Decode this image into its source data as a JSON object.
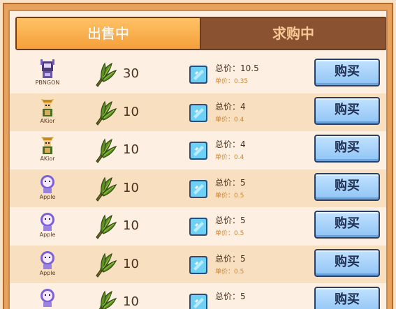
{
  "tabs": {
    "sell": "出售中",
    "buy": "求购中"
  },
  "listings": [
    {
      "seller": "PBNGON",
      "avatar": "robot-avatar-icon",
      "quantity": "30",
      "total_label": "总价：",
      "total": "10.5",
      "unit_label": "单价：",
      "unit_price": "0.35",
      "button": "购买",
      "row_style": "plain"
    },
    {
      "seller": "AKior",
      "avatar": "warrior-avatar-icon",
      "quantity": "10",
      "total_label": "总价：",
      "total": "4",
      "unit_label": "单价：",
      "unit_price": "0.4",
      "button": "购买",
      "row_style": "alt"
    },
    {
      "seller": "AKior",
      "avatar": "warrior-avatar-icon",
      "quantity": "10",
      "total_label": "总价：",
      "total": "4",
      "unit_label": "单价：",
      "unit_price": "0.4",
      "button": "购买",
      "row_style": "plain"
    },
    {
      "seller": "Apple",
      "avatar": "astronaut-avatar-icon",
      "quantity": "10",
      "total_label": "总价：",
      "total": "5",
      "unit_label": "单价：",
      "unit_price": "0.5",
      "button": "购买",
      "row_style": "alt"
    },
    {
      "seller": "Apple",
      "avatar": "astronaut-avatar-icon",
      "quantity": "10",
      "total_label": "总价：",
      "total": "5",
      "unit_label": "单价：",
      "unit_price": "0.5",
      "button": "购买",
      "row_style": "plain"
    },
    {
      "seller": "Apple",
      "avatar": "astronaut-avatar-icon",
      "quantity": "10",
      "total_label": "总价：",
      "total": "5",
      "unit_label": "单价：",
      "unit_price": "0.5",
      "button": "购买",
      "row_style": "alt"
    },
    {
      "seller": "",
      "avatar": "astronaut-avatar-icon",
      "quantity": "10",
      "total_label": "总价：",
      "total": "5",
      "unit_label": "",
      "unit_price": "",
      "button": "购买",
      "row_style": "plain"
    }
  ],
  "item_icon": "wheat-bundle-icon",
  "currency_icon": "blue-gem-icon",
  "colors": {
    "tab_active": "#f5a03a",
    "tab_inactive": "#8a5231",
    "button": "#8fc4f5",
    "frame": "#e7a25e"
  }
}
